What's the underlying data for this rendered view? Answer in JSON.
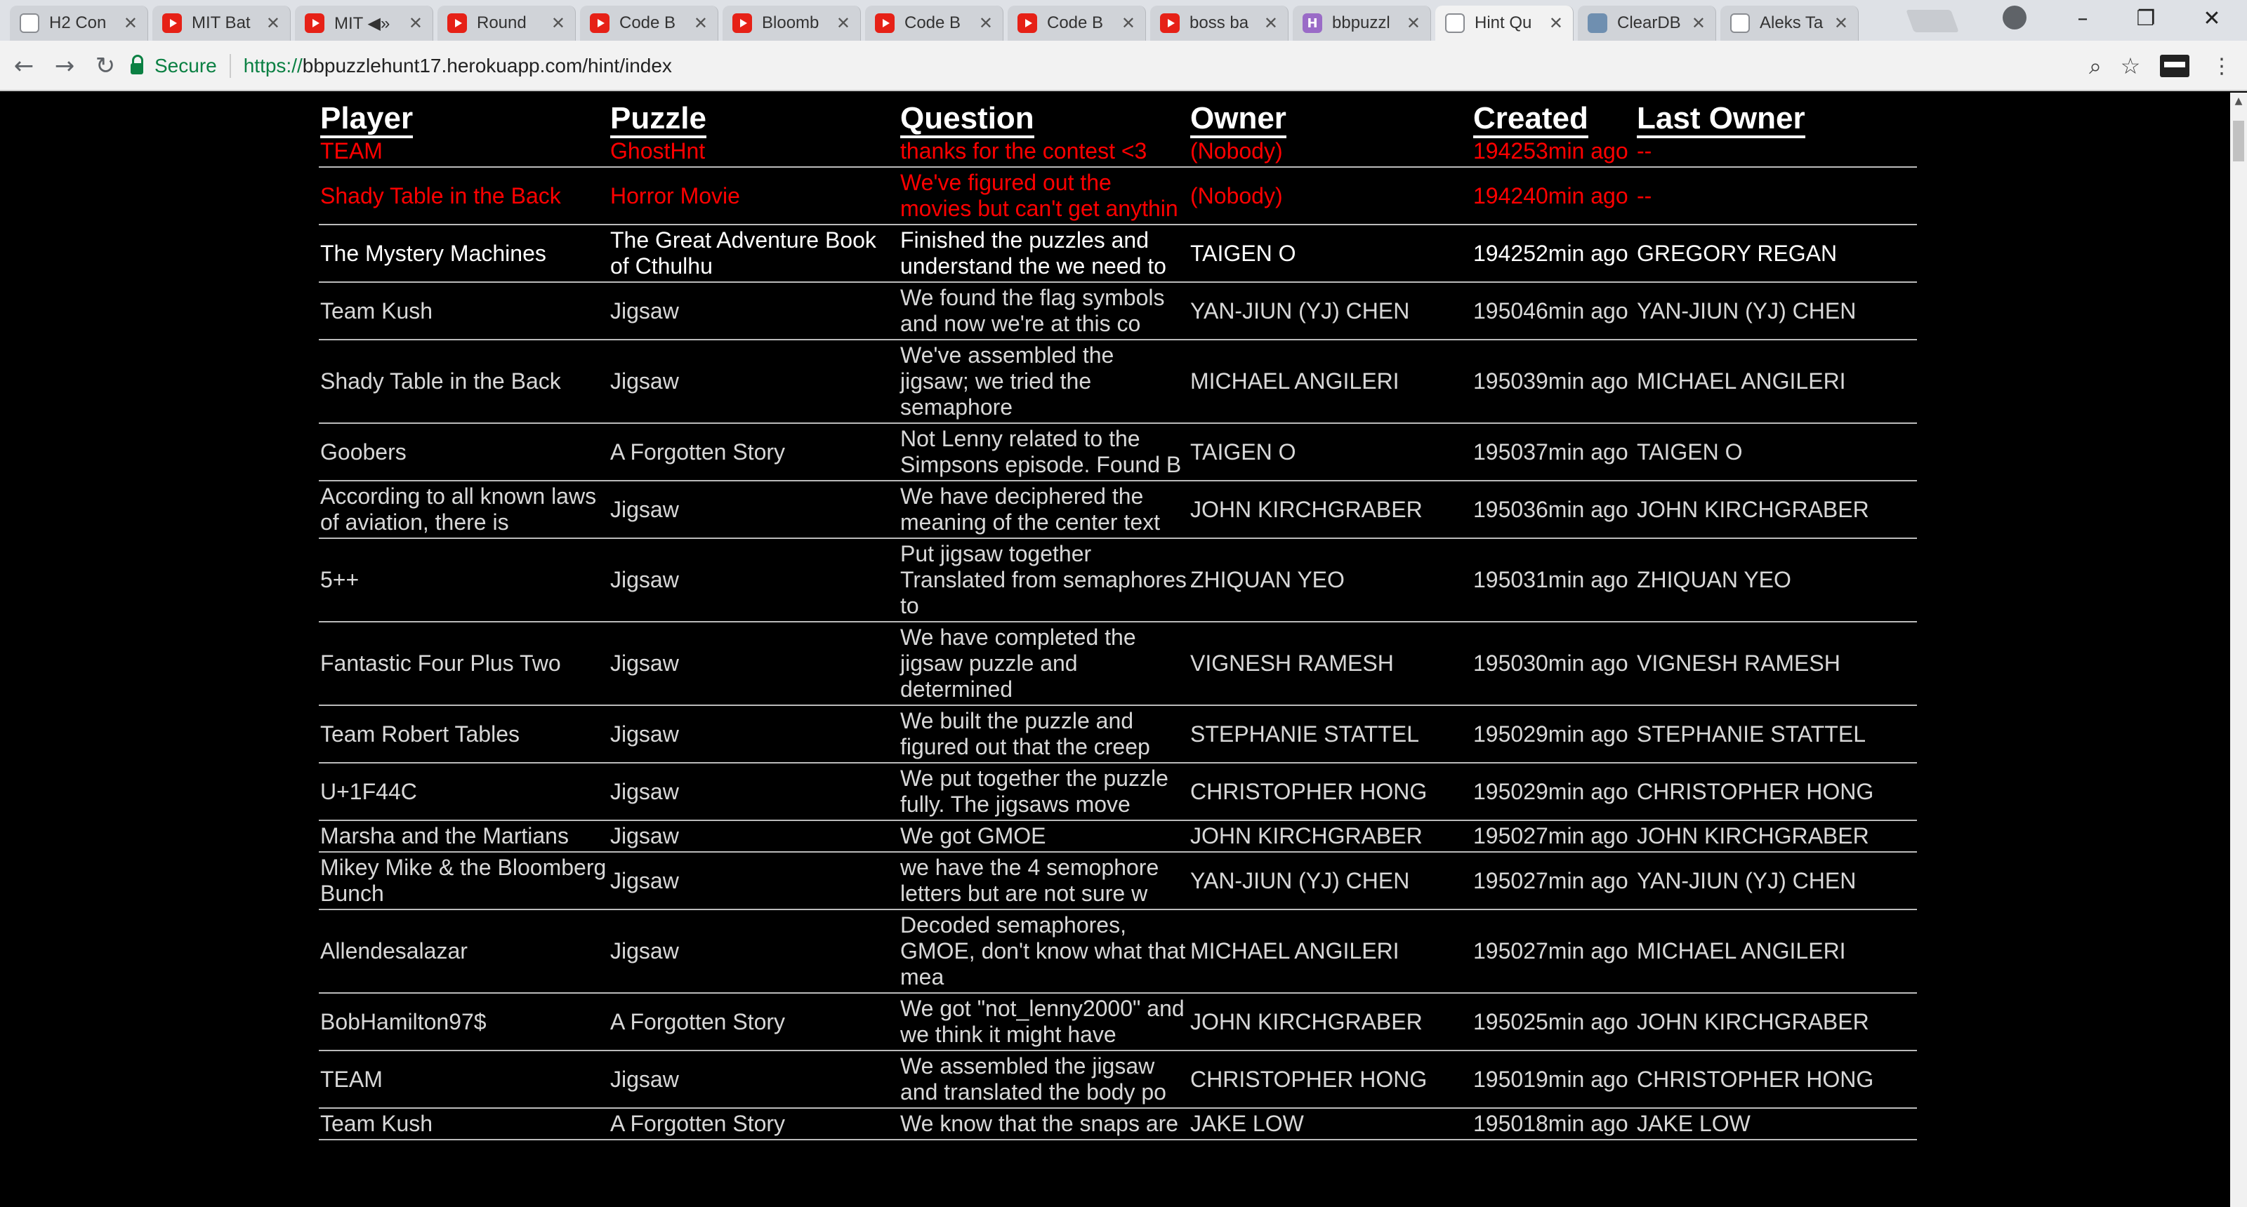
{
  "browser": {
    "tabs": [
      {
        "title": "H2 Con",
        "icon": "page-icon"
      },
      {
        "title": "MIT Bat",
        "icon": "youtube-icon"
      },
      {
        "title": "MIT ◀»",
        "icon": "youtube-icon"
      },
      {
        "title": "Round",
        "icon": "youtube-icon"
      },
      {
        "title": "Code B",
        "icon": "youtube-icon"
      },
      {
        "title": "Bloomb",
        "icon": "youtube-icon"
      },
      {
        "title": "Code B",
        "icon": "youtube-icon"
      },
      {
        "title": "Code B",
        "icon": "youtube-icon"
      },
      {
        "title": "boss ba",
        "icon": "youtube-icon"
      },
      {
        "title": "bbpuzzl",
        "icon": "h-app-icon"
      },
      {
        "title": "Hint Qu",
        "icon": "page-icon"
      },
      {
        "title": "ClearDB",
        "icon": "database-icon"
      },
      {
        "title": "Aleks Ta",
        "icon": "page-icon"
      }
    ],
    "active_tab_index": 10,
    "secure_label": "Secure",
    "url_scheme": "https://",
    "url_rest": "bbpuzzlehunt17.herokuapp.com/hint/index",
    "accent": "#0b8043"
  },
  "table": {
    "headers": {
      "player": "Player",
      "puzzle": "Puzzle",
      "question": "Question",
      "owner": "Owner",
      "created": "Created",
      "last_owner": "Last Owner"
    },
    "colors": {
      "unowned": "#ff0000",
      "active": "#ffffff",
      "normal": "#d8d8d8"
    },
    "rows": [
      {
        "player": "TEAM",
        "puzzle": "GhostHnt",
        "question": "thanks for the contest <3",
        "owner": "(Nobody)",
        "created": "194253min ago",
        "last_owner": "--",
        "state": "unowned"
      },
      {
        "player": "Shady Table in the Back",
        "puzzle": "Horror Movie",
        "question": "We've figured out the movies but can't get anythin",
        "owner": "(Nobody)",
        "created": "194240min ago",
        "last_owner": "--",
        "state": "unowned"
      },
      {
        "player": "The Mystery Machines",
        "puzzle": "The Great Adventure Book of Cthulhu",
        "question": "Finished the puzzles and understand the we need to",
        "owner": "TAIGEN O",
        "created": "194252min ago",
        "last_owner": "GREGORY REGAN",
        "state": "active"
      },
      {
        "player": "Team Kush",
        "puzzle": "Jigsaw",
        "question": "We found the flag symbols and now we're at this co",
        "owner": "YAN-JIUN (YJ) CHEN",
        "created": "195046min ago",
        "last_owner": "YAN-JIUN (YJ) CHEN",
        "state": "normal"
      },
      {
        "player": "Shady Table in the Back",
        "puzzle": "Jigsaw",
        "question": "We've assembled the jigsaw; we tried the semaphore",
        "owner": "MICHAEL ANGILERI",
        "created": "195039min ago",
        "last_owner": "MICHAEL ANGILERI",
        "state": "normal"
      },
      {
        "player": "Goobers",
        "puzzle": "A Forgotten Story",
        "question": "Not Lenny related to the Simpsons episode. Found B",
        "owner": "TAIGEN O",
        "created": "195037min ago",
        "last_owner": "TAIGEN O",
        "state": "normal"
      },
      {
        "player": "According to all known laws of aviation, there is",
        "puzzle": "Jigsaw",
        "question": "We have deciphered the meaning of the center text",
        "owner": "JOHN KIRCHGRABER",
        "created": "195036min ago",
        "last_owner": "JOHN KIRCHGRABER",
        "state": "normal"
      },
      {
        "player": "5++",
        "puzzle": "Jigsaw",
        "question": "Put jigsaw together Translated from semaphores to",
        "owner": "ZHIQUAN YEO",
        "created": "195031min ago",
        "last_owner": "ZHIQUAN YEO",
        "state": "normal"
      },
      {
        "player": "Fantastic Four Plus Two",
        "puzzle": "Jigsaw",
        "question": "We have completed the jigsaw puzzle and determined",
        "owner": "VIGNESH RAMESH",
        "created": "195030min ago",
        "last_owner": "VIGNESH RAMESH",
        "state": "normal"
      },
      {
        "player": "Team Robert Tables",
        "puzzle": "Jigsaw",
        "question": "We built the puzzle and figured out that the creep",
        "owner": "STEPHANIE STATTEL",
        "created": "195029min ago",
        "last_owner": "STEPHANIE STATTEL",
        "state": "normal"
      },
      {
        "player": "U+1F44C",
        "puzzle": "Jigsaw",
        "question": "We put together the puzzle fully. The jigsaws move",
        "owner": "CHRISTOPHER HONG",
        "created": "195029min ago",
        "last_owner": "CHRISTOPHER HONG",
        "state": "normal"
      },
      {
        "player": "Marsha and the Martians",
        "puzzle": "Jigsaw",
        "question": "We got GMOE",
        "owner": "JOHN KIRCHGRABER",
        "created": "195027min ago",
        "last_owner": "JOHN KIRCHGRABER",
        "state": "normal"
      },
      {
        "player": "Mikey Mike & the Bloomberg Bunch",
        "puzzle": "Jigsaw",
        "question": "we have the 4 semophore letters but are not sure w",
        "owner": "YAN-JIUN (YJ) CHEN",
        "created": "195027min ago",
        "last_owner": "YAN-JIUN (YJ) CHEN",
        "state": "normal"
      },
      {
        "player": "Allendesalazar",
        "puzzle": "Jigsaw",
        "question": "Decoded semaphores, GMOE, don't know what that mea",
        "owner": "MICHAEL ANGILERI",
        "created": "195027min ago",
        "last_owner": "MICHAEL ANGILERI",
        "state": "normal"
      },
      {
        "player": "BobHamilton97$",
        "puzzle": "A Forgotten Story",
        "question": "We got \"not_lenny2000\" and we think it might have",
        "owner": "JOHN KIRCHGRABER",
        "created": "195025min ago",
        "last_owner": "JOHN KIRCHGRABER",
        "state": "normal"
      },
      {
        "player": "TEAM",
        "puzzle": "Jigsaw",
        "question": "We assembled the jigsaw and translated the body po",
        "owner": "CHRISTOPHER HONG",
        "created": "195019min ago",
        "last_owner": "CHRISTOPHER HONG",
        "state": "normal"
      },
      {
        "player": "Team Kush",
        "puzzle": "A Forgotten Story",
        "question": "We know that the snaps are",
        "owner": "JAKE LOW",
        "created": "195018min ago",
        "last_owner": "JAKE LOW",
        "state": "normal"
      }
    ]
  }
}
